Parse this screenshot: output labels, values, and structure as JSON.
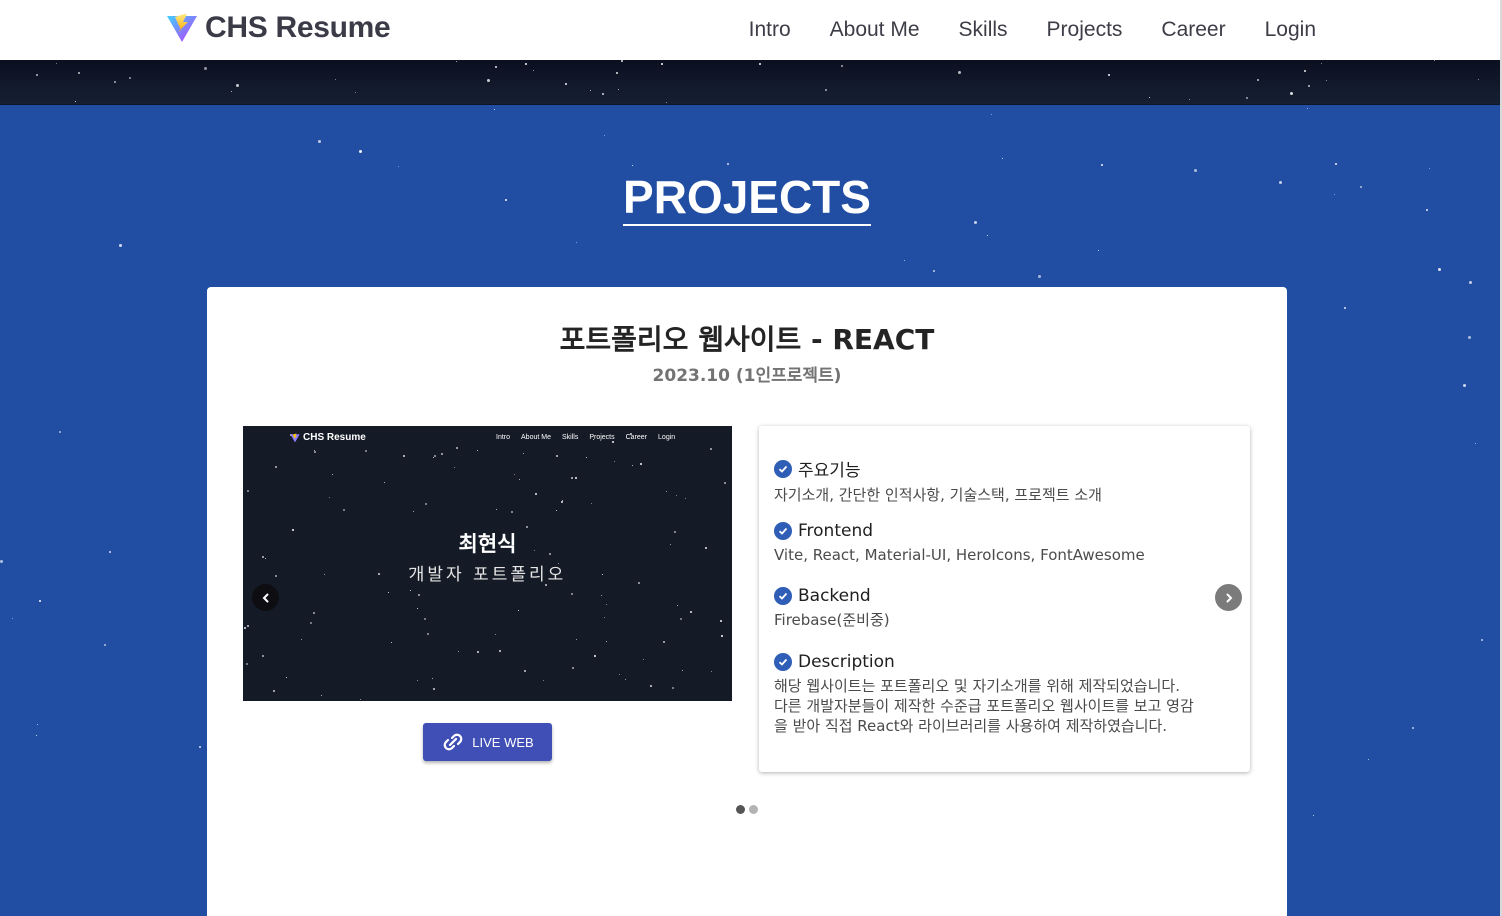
{
  "brand": {
    "name": "CHS Resume",
    "accent": "#214ea3"
  },
  "nav": {
    "items": [
      "Intro",
      "About Me",
      "Skills",
      "Projects",
      "Career",
      "Login"
    ]
  },
  "section": {
    "title": "PROJECTS"
  },
  "project": {
    "title": "포트폴리오 웹사이트 - REACT",
    "date": "2023.10 (1인프로젝트)",
    "preview": {
      "brand": "CHS Resume",
      "nav": [
        "Intro",
        "About Me",
        "Skills",
        "Projects",
        "Career",
        "Login"
      ],
      "name": "최현식",
      "subtitle": "개발자 포트폴리오"
    },
    "live_button": {
      "label": "LIVE WEB",
      "icon": "link-icon"
    },
    "details": [
      {
        "heading": "주요기능",
        "body": "자기소개, 간단한 인적사항, 기술스택, 프로젝트 소개"
      },
      {
        "heading": "Frontend",
        "body": "Vite, React, Material-UI, HeroIcons, FontAwesome"
      },
      {
        "heading": "Backend",
        "body": "Firebase(준비중)"
      },
      {
        "heading": "Description",
        "body": "해당 웹사이트는 포트폴리오 및 자기소개를 위해 제작되었습니다.\n다른 개발자분들이 제작한 수준급 포트폴리오 웹사이트를 보고 영감\n을 받아 직접 React와 라이브러리를 사용하여 제작하였습니다."
      }
    ]
  },
  "carousel": {
    "prev_icon": "chevron-left-icon",
    "next_icon": "chevron-right-icon",
    "total_slides": 2,
    "active_slide": 1
  }
}
